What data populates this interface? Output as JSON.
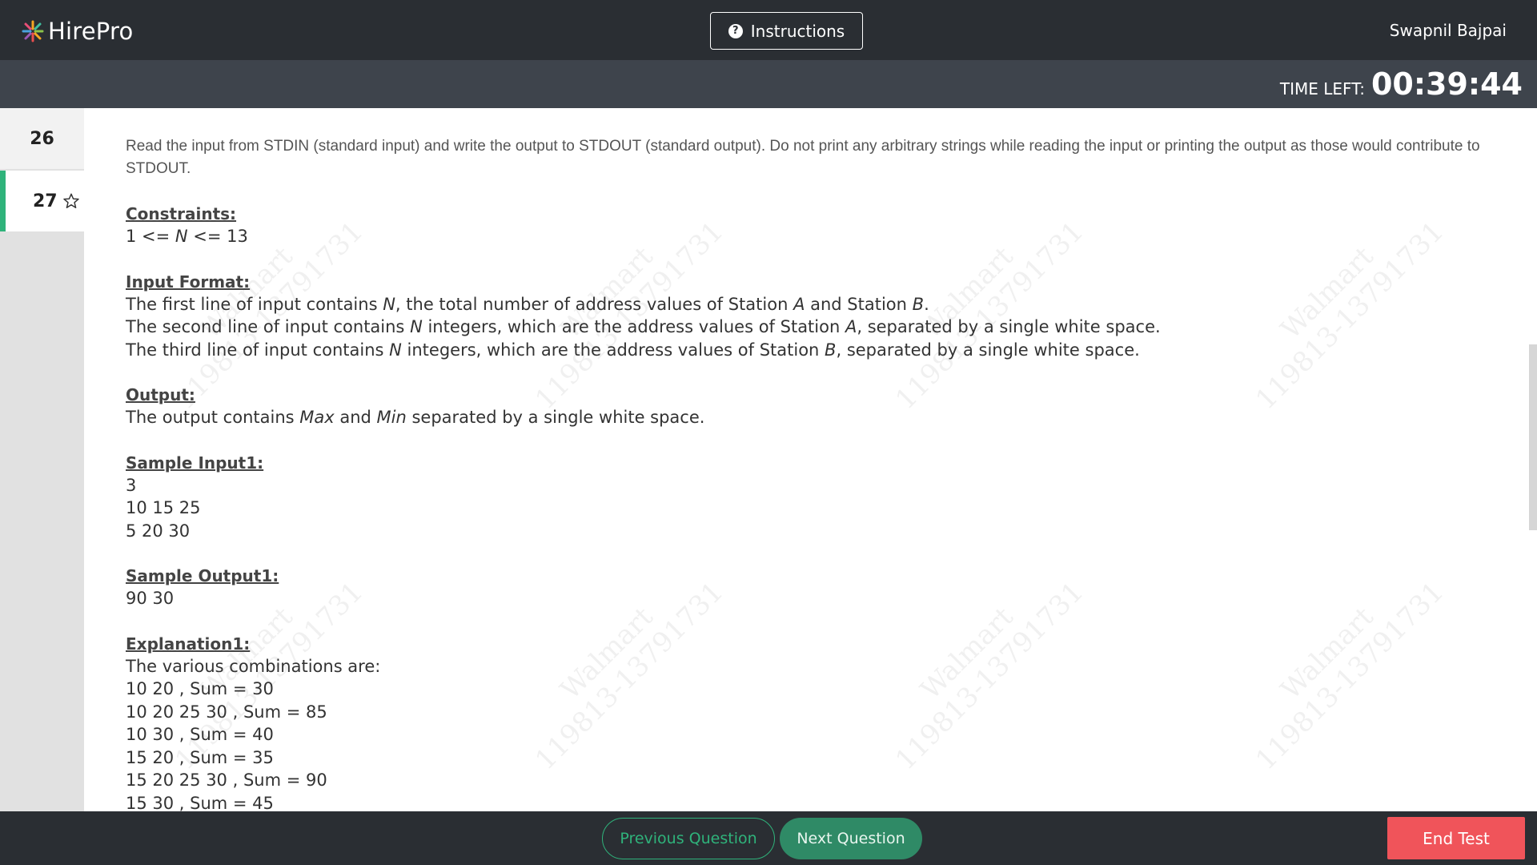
{
  "header": {
    "logo_text": "HirePro",
    "instructions_label": "Instructions",
    "username": "Swapnil Bajpai"
  },
  "timer": {
    "label": "TIME LEFT:",
    "value": "00:39:44"
  },
  "sidebar": {
    "questions": [
      {
        "number": "26",
        "active": false
      },
      {
        "number": "27",
        "active": true,
        "icon": "star-outline-icon"
      }
    ]
  },
  "question": {
    "intro": "Read the input from STDIN (standard input) and write the output to STDOUT (standard output). Do not print any arbitrary strings while reading the input or printing the output as those would contribute to STDOUT.",
    "constraints_title": "Constraints:",
    "constraints": "1 <= N <= 13",
    "input_format_title": "Input Format:",
    "input_format": [
      "The first line of input contains N, the total number of address values of Station A and Station B.",
      "The second line of input contains N integers, which are the address values of Station A, separated by a single white space.",
      "The third line of input contains N integers, which are the address values of Station B, separated by a single white space."
    ],
    "output_title": "Output:",
    "output": "The output contains Max and Min separated by a single white space.",
    "sample_input_title": "Sample Input1:",
    "sample_input": [
      "3",
      "10 15 25",
      "5 20 30"
    ],
    "sample_output_title": "Sample Output1:",
    "sample_output": "90 30",
    "explanation_title": "Explanation1:",
    "explanation": [
      "The various combinations are:",
      "10 20 , Sum = 30",
      "10 20 25 30 , Sum = 85",
      "10 30 , Sum = 40",
      "15 20 , Sum = 35",
      "15 20 25 30 , Sum = 90",
      "15 30 , Sum = 45"
    ]
  },
  "watermark": {
    "line1": "Walmart",
    "line2": "119813-13791731"
  },
  "footer": {
    "prev_label": "Previous Question",
    "next_label": "Next Question",
    "end_label": "End Test"
  },
  "colors": {
    "header_bg": "#2a2e33",
    "timer_bg": "#3e444c",
    "accent_green": "#2fb37b",
    "end_red": "#f0545a"
  }
}
